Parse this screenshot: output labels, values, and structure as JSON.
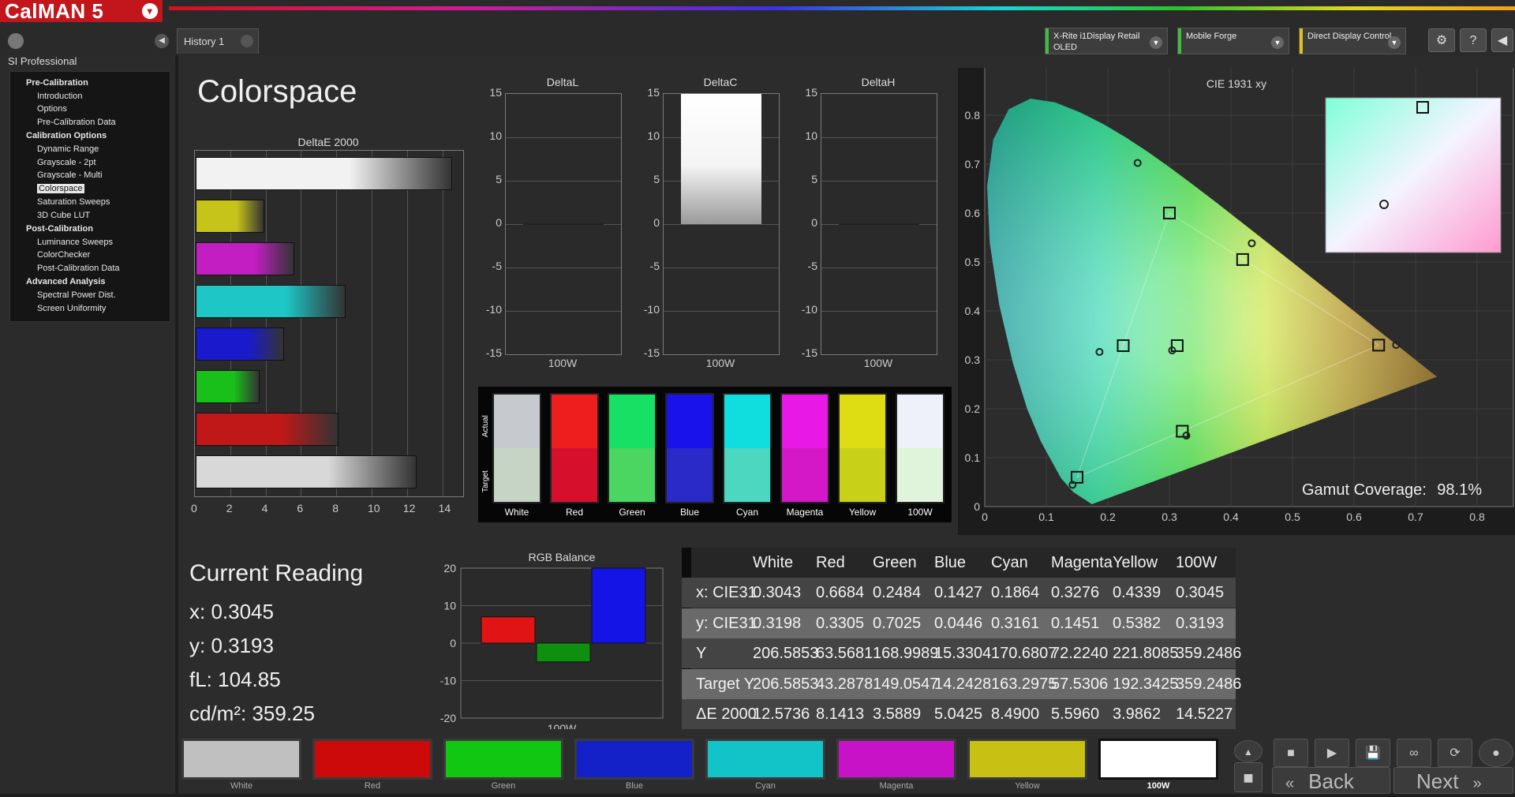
{
  "app": {
    "logo": "CalMAN 5",
    "logo_arrow": "▾"
  },
  "tabs": [
    {
      "label": "History 1"
    }
  ],
  "devices": [
    {
      "line1": "X-Rite i1Display Retail",
      "line2": "OLED",
      "color": "#3fbf3f"
    },
    {
      "line1": "Mobile Forge",
      "line2": "",
      "color": "#3fbf3f"
    },
    {
      "line1": "Direct Display Control",
      "line2": "",
      "color": "#e0c020"
    }
  ],
  "toolbar": {
    "settings_icon": "⚙",
    "help_label": "?",
    "collapse_icon": "◀"
  },
  "sidebar": {
    "title": "SI Professional",
    "collapse_icon": "◀",
    "items": [
      {
        "label": "Pre-Calibration",
        "level": 0
      },
      {
        "label": "Introduction",
        "level": 1
      },
      {
        "label": "Options",
        "level": 1
      },
      {
        "label": "Pre-Calibration Data",
        "level": 1
      },
      {
        "label": "Calibration Options",
        "level": 0
      },
      {
        "label": "Dynamic Range",
        "level": 1
      },
      {
        "label": "Grayscale - 2pt",
        "level": 1
      },
      {
        "label": "Grayscale - Multi",
        "level": 1
      },
      {
        "label": "Colorspace",
        "level": 1,
        "selected": true
      },
      {
        "label": "Saturation Sweeps",
        "level": 1
      },
      {
        "label": "3D Cube LUT",
        "level": 1
      },
      {
        "label": "Post-Calibration",
        "level": 0
      },
      {
        "label": "Luminance Sweeps",
        "level": 1
      },
      {
        "label": "ColorChecker",
        "level": 1
      },
      {
        "label": "Post-Calibration Data",
        "level": 1
      },
      {
        "label": "Advanced Analysis",
        "level": 0
      },
      {
        "label": "Spectral Power Dist.",
        "level": 1
      },
      {
        "label": "Screen Uniformity",
        "level": 1
      }
    ]
  },
  "page": {
    "title": "Colorspace"
  },
  "deltae_chart": {
    "title": "DeltaE 2000",
    "ticks": [
      "0",
      "2",
      "4",
      "6",
      "8",
      "10",
      "12",
      "14"
    ]
  },
  "delta_charts": [
    {
      "title": "DeltaL",
      "xlabel": "100W"
    },
    {
      "title": "DeltaC",
      "xlabel": "100W"
    },
    {
      "title": "DeltaH",
      "xlabel": "100W"
    }
  ],
  "delta_ticks": [
    "15",
    "10",
    "5",
    "0",
    "-5",
    "-10",
    "-15"
  ],
  "swatch_panel": {
    "actual_label": "Actual",
    "target_label": "Target"
  },
  "swatches": [
    {
      "label": "White",
      "actual": "#c6c9ce",
      "target": "#c6d4c6"
    },
    {
      "label": "Red",
      "actual": "#ef1e1e",
      "target": "#d6102c"
    },
    {
      "label": "Green",
      "actual": "#18e064",
      "target": "#4ad660"
    },
    {
      "label": "Blue",
      "actual": "#1a12ea",
      "target": "#2a2ac8"
    },
    {
      "label": "Cyan",
      "actual": "#10dede",
      "target": "#4cd8c0"
    },
    {
      "label": "Magenta",
      "actual": "#e818e6",
      "target": "#d418c8"
    },
    {
      "label": "Yellow",
      "actual": "#dedc12",
      "target": "#c8d018"
    },
    {
      "label": "100W",
      "actual": "#eef0fa",
      "target": "#e0f4dc"
    }
  ],
  "cie": {
    "title": "CIE 1931 xy",
    "gamut_label": "Gamut Coverage:",
    "gamut_value": "98.1%",
    "xticks": [
      "0",
      "0.1",
      "0.2",
      "0.3",
      "0.4",
      "0.5",
      "0.6",
      "0.7",
      "0.8"
    ],
    "yticks": [
      "0",
      "0.1",
      "0.2",
      "0.3",
      "0.4",
      "0.5",
      "0.6",
      "0.7",
      "0.8"
    ]
  },
  "current_reading": {
    "title": "Current Reading",
    "x": "x: 0.3045",
    "y": "y: 0.3193",
    "fl": "fL: 104.85",
    "cdm2": "cd/m²: 359.25"
  },
  "rgb_balance": {
    "title": "RGB Balance",
    "xlabel": "100W",
    "ticks": [
      "20",
      "10",
      "0",
      "-10",
      "-20"
    ]
  },
  "table": {
    "columns": [
      "",
      "White",
      "Red",
      "Green",
      "Blue",
      "Cyan",
      "Magenta",
      "Yellow",
      "100W"
    ],
    "rows": [
      [
        "x: CIE31",
        "0.3043",
        "0.6684",
        "0.2484",
        "0.1427",
        "0.1864",
        "0.3276",
        "0.4339",
        "0.3045"
      ],
      [
        "y: CIE31",
        "0.3198",
        "0.3305",
        "0.7025",
        "0.0446",
        "0.3161",
        "0.1451",
        "0.5382",
        "0.3193"
      ],
      [
        "Y",
        "206.5853",
        "63.5681",
        "168.9989",
        "15.3304",
        "170.6807",
        "72.2240",
        "221.8085",
        "359.2486"
      ],
      [
        "Target Y",
        "206.5853",
        "43.2878",
        "149.0547",
        "14.2428",
        "163.2975",
        "57.5306",
        "192.3425",
        "359.2486"
      ],
      [
        "ΔE 2000",
        "12.5736",
        "8.1413",
        "3.5889",
        "5.0425",
        "8.4900",
        "5.5960",
        "3.9862",
        "14.5227"
      ]
    ]
  },
  "bottom_swatches": [
    {
      "label": "White",
      "color": "#c0c0c0"
    },
    {
      "label": "Red",
      "color": "#cc0a0a"
    },
    {
      "label": "Green",
      "color": "#12c712"
    },
    {
      "label": "Blue",
      "color": "#1420c8"
    },
    {
      "label": "Cyan",
      "color": "#12c4c8"
    },
    {
      "label": "Magenta",
      "color": "#c812c8"
    },
    {
      "label": "Yellow",
      "color": "#c8c012"
    },
    {
      "label": "100W",
      "color": "#ffffff"
    }
  ],
  "controls": {
    "stop": "■",
    "play": "▶",
    "save": "💾",
    "loop": "∞",
    "refresh": "⟳",
    "record": "●"
  },
  "nav": {
    "back_label": "Back",
    "next_label": "Next",
    "back_icon": "«",
    "next_icon": "»"
  },
  "chart_data": [
    {
      "type": "bar",
      "title": "DeltaE 2000",
      "categories": [
        "White",
        "Yellow",
        "Magenta",
        "Cyan",
        "Blue",
        "Green",
        "Red",
        "100W"
      ],
      "values": [
        14.5,
        3.9,
        5.6,
        8.5,
        5.0,
        3.6,
        8.1,
        12.5
      ],
      "colors": [
        "#f2f2f2",
        "#c6c41a",
        "#c21ec2",
        "#1ec6c6",
        "#1a1acc",
        "#1ac01a",
        "#c01818",
        "#d8d8d8"
      ],
      "xlim": [
        0,
        15
      ]
    },
    {
      "type": "bar",
      "title": "DeltaL",
      "categories": [
        "100W"
      ],
      "values": [
        0
      ],
      "ylim": [
        -15,
        15
      ]
    },
    {
      "type": "bar",
      "title": "DeltaC",
      "categories": [
        "100W"
      ],
      "values": [
        15
      ],
      "ylim": [
        -15,
        15
      ]
    },
    {
      "type": "bar",
      "title": "DeltaH",
      "categories": [
        "100W"
      ],
      "values": [
        0
      ],
      "ylim": [
        -15,
        15
      ]
    },
    {
      "type": "bar",
      "title": "RGB Balance",
      "categories": [
        "100W"
      ],
      "series": [
        {
          "values": [
            7
          ]
        },
        {
          "values": [
            -5
          ]
        },
        {
          "values": [
            20
          ]
        }
      ],
      "colors": [
        "#e01414",
        "#0e900e",
        "#1414e6"
      ],
      "ylim": [
        -20,
        20
      ]
    },
    {
      "type": "scatter",
      "title": "CIE 1931 xy",
      "xlim": [
        0,
        0.8
      ],
      "ylim": [
        0,
        0.8
      ],
      "target": [
        [
          0.64,
          0.33
        ],
        [
          0.3,
          0.6
        ],
        [
          0.15,
          0.06
        ],
        [
          0.225,
          0.329
        ],
        [
          0.321,
          0.154
        ],
        [
          0.419,
          0.505
        ],
        [
          0.3127,
          0.329
        ]
      ],
      "measured": [
        [
          0.6684,
          0.3305
        ],
        [
          0.2484,
          0.7025
        ],
        [
          0.1427,
          0.0446
        ],
        [
          0.1864,
          0.3161
        ],
        [
          0.3276,
          0.1451
        ],
        [
          0.4339,
          0.5382
        ],
        [
          0.3045,
          0.3193
        ]
      ]
    }
  ]
}
